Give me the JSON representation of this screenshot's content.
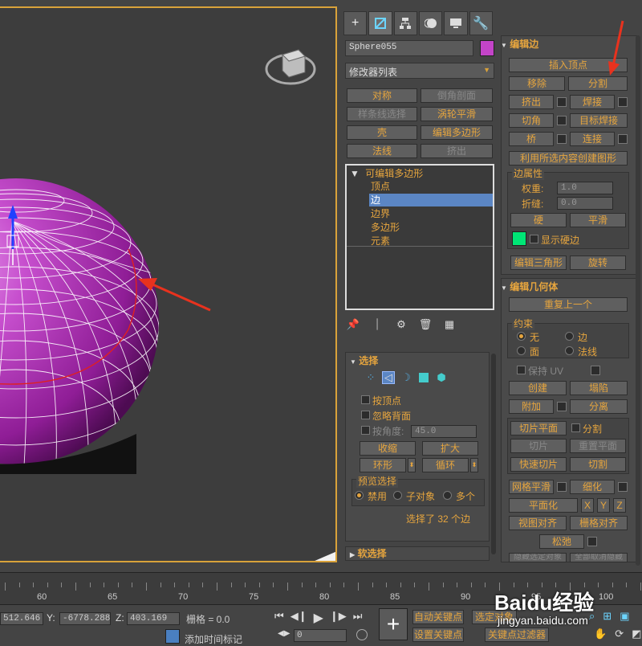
{
  "command_panel": {
    "object_name": "Sphere055",
    "modifier_list": "修改器列表",
    "quick_buttons": [
      "对称",
      "倒角剖面",
      "样条线选择",
      "涡轮平滑",
      "壳",
      "编辑多边形",
      "法线",
      "挤出"
    ],
    "stack": {
      "root": "可编辑多边形",
      "items": [
        "顶点",
        "边",
        "边界",
        "多边形",
        "元素"
      ],
      "selected_index": 1
    },
    "selection": {
      "title": "选择",
      "by_vertex": "按顶点",
      "ignore_backface": "忽略背面",
      "by_angle": "按角度:",
      "angle_value": "45.0",
      "shrink": "收缩",
      "grow": "扩大",
      "ring": "环形",
      "loop": "循环",
      "preview_title": "预览选择",
      "preview_options": [
        "禁用",
        "子对象",
        "多个"
      ],
      "status": "选择了 32 个边"
    },
    "soft_selection": "软选择"
  },
  "edit_edges": {
    "title": "编辑边",
    "insert_vertex": "插入顶点",
    "remove": "移除",
    "split": "分割",
    "extrude": "挤出",
    "weld": "焊接",
    "chamfer": "切角",
    "target_weld": "目标焊接",
    "bridge": "桥",
    "connect": "连接",
    "create_shape": "利用所选内容创建图形",
    "edge_props": "边属性",
    "weight_label": "权重:",
    "weight_value": "1.0",
    "crease_label": "折缝:",
    "crease_value": "0.0",
    "hard": "硬",
    "smooth": "平滑",
    "show_hard": "显示硬边",
    "edit_tri": "编辑三角形",
    "turn": "旋转"
  },
  "edit_geometry": {
    "title": "编辑几何体",
    "repeat_last": "重复上一个",
    "constraints": "约束",
    "constraint_options": [
      "无",
      "边",
      "面",
      "法线"
    ],
    "preserve_uv": "保持 UV",
    "create": "创建",
    "collapse": "塌陷",
    "attach": "附加",
    "detach": "分离",
    "slice_plane": "切片平面",
    "split": "分割",
    "slice": "切片",
    "reset_plane": "重置平面",
    "quickslice": "快速切片",
    "cut": "切割",
    "meshsmooth": "网格平滑",
    "tessellate": "细化",
    "make_planar": "平面化",
    "x": "X",
    "y": "Y",
    "z": "Z",
    "view_align": "视图对齐",
    "grid_align": "栅格对齐",
    "relax": "松弛",
    "hide_sel": "隐藏选定对象",
    "unhide_all": "全部取消隐藏"
  },
  "timeline": {
    "labels": [
      "60",
      "65",
      "70",
      "75",
      "80",
      "85",
      "90",
      "95",
      "100"
    ]
  },
  "statusbar": {
    "x_value": "512.646",
    "y_label": "Y:",
    "y_value": "-6778.288",
    "z_label": "Z:",
    "z_value": "403.169",
    "grid": "栅格 = 0.0",
    "add_time_tag": "添加时间标记",
    "auto_key": "自动关键点",
    "set_key": "设置关键点",
    "selected": "选定对象",
    "key_filters": "关键点过滤器",
    "frame": "0"
  },
  "watermark": {
    "brand": "Baidu经验",
    "url": "jingyan.baidu.com"
  },
  "colors": {
    "accent": "#e6a53e",
    "sphere": "#c344c8",
    "selection_blue": "#5b86c4",
    "hard_edge_swatch": "#00e676",
    "arrow": "#e8321e"
  }
}
